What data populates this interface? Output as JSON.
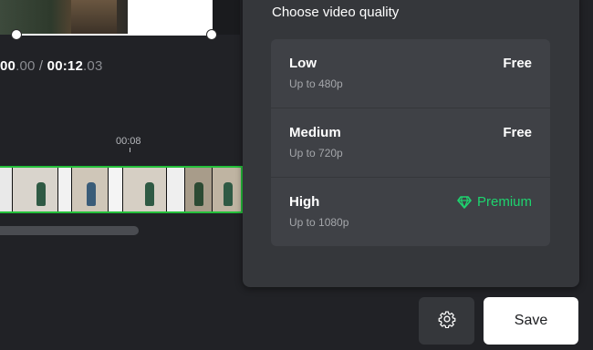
{
  "playback": {
    "current_main": "00",
    "current_frac": ".00",
    "separator": " / ",
    "total_main": "00:12",
    "total_frac": ".03"
  },
  "timeline": {
    "ruler_label": "00:08",
    "scroll_position": 0.57
  },
  "quality_panel": {
    "title": "Choose video quality",
    "options": [
      {
        "name": "Low",
        "resolution": "Up to 480p",
        "tier": "Free",
        "tier_icon": ""
      },
      {
        "name": "Medium",
        "resolution": "Up to 720p",
        "tier": "Free",
        "tier_icon": ""
      },
      {
        "name": "High",
        "resolution": "Up to 1080p",
        "tier": "Premium",
        "tier_icon": "diamond-icon"
      }
    ]
  },
  "actions": {
    "settings_icon": "gear-icon",
    "save_label": "Save"
  },
  "colors": {
    "accent_green": "#1ed46f",
    "filmstrip_border": "#25c03b",
    "panel_bg": "#35373b",
    "option_bg": "#3f4146",
    "page_bg": "#212226"
  }
}
